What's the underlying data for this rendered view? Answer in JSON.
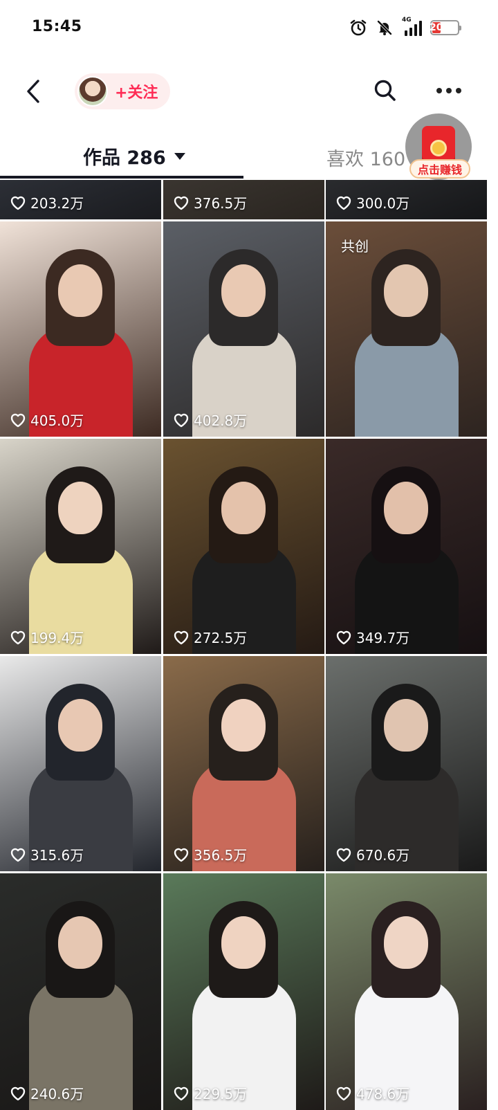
{
  "status_bar": {
    "time": "15:45",
    "icons": [
      "alarm-icon",
      "mute-bell-icon",
      "signal-4g-icon"
    ],
    "network_label": "4G",
    "battery_level": "20",
    "battery_fraction": 0.2
  },
  "nav": {
    "back_icon": "chevron-left-icon",
    "follow_label": "+关注",
    "search_icon": "search-icon",
    "more_icon": "more-dots-icon"
  },
  "tabs": {
    "works_label": "作品 286",
    "likes_label": "喜欢 160"
  },
  "promo": {
    "label": "点击赚钱",
    "icon": "red-packet-icon"
  },
  "videos": [
    {
      "likes": "203.2万",
      "cocreate": ""
    },
    {
      "likes": "376.5万",
      "cocreate": ""
    },
    {
      "likes": "300.0万",
      "cocreate": ""
    },
    {
      "likes": "405.0万",
      "cocreate": ""
    },
    {
      "likes": "402.8万",
      "cocreate": ""
    },
    {
      "likes": "",
      "cocreate": "共创"
    },
    {
      "likes": "199.4万",
      "cocreate": ""
    },
    {
      "likes": "272.5万",
      "cocreate": ""
    },
    {
      "likes": "349.7万",
      "cocreate": ""
    },
    {
      "likes": "315.6万",
      "cocreate": ""
    },
    {
      "likes": "356.5万",
      "cocreate": ""
    },
    {
      "likes": "670.6万",
      "cocreate": ""
    },
    {
      "likes": "240.6万",
      "cocreate": ""
    },
    {
      "likes": "229.5万",
      "cocreate": ""
    },
    {
      "likes": "478.6万",
      "cocreate": ""
    }
  ],
  "colors": {
    "accent": "#fe2c55",
    "follow_chip_bg": "#fdeeee",
    "battery_low": "#e53935"
  }
}
